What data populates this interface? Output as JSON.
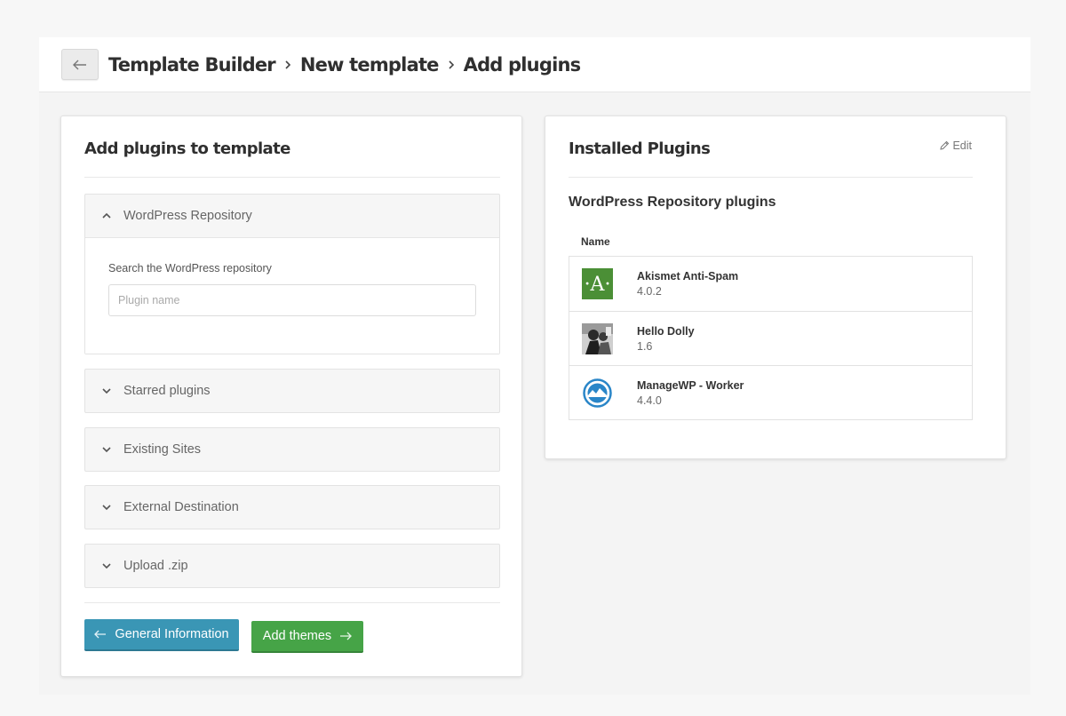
{
  "breadcrumb": {
    "items": [
      "Template Builder",
      "New template",
      "Add plugins"
    ]
  },
  "left": {
    "title": "Add plugins to template",
    "repository": {
      "label": "WordPress Repository",
      "search_label": "Search the WordPress repository",
      "search_placeholder": "Plugin name",
      "search_value": ""
    },
    "sections": [
      "Starred plugins",
      "Existing Sites",
      "External Destination",
      "Upload .zip"
    ],
    "buttons": {
      "back": "General Information",
      "next": "Add themes"
    }
  },
  "right": {
    "title": "Installed Plugins",
    "edit_label": "Edit",
    "subtitle": "WordPress Repository plugins",
    "column_name": "Name",
    "plugins": [
      {
        "name": "Akismet Anti-Spam",
        "version": "4.0.2",
        "icon": "akismet-icon",
        "icon_letter": "·A·"
      },
      {
        "name": "Hello Dolly",
        "version": "1.6",
        "icon": "hello-dolly-icon"
      },
      {
        "name": "ManageWP - Worker",
        "version": "4.4.0",
        "icon": "managewp-icon"
      }
    ]
  },
  "colors": {
    "primary_blue": "#3a96b5",
    "success_green": "#46a447",
    "akismet_green": "#4b8f36",
    "managewp_blue": "#2a86c8"
  }
}
